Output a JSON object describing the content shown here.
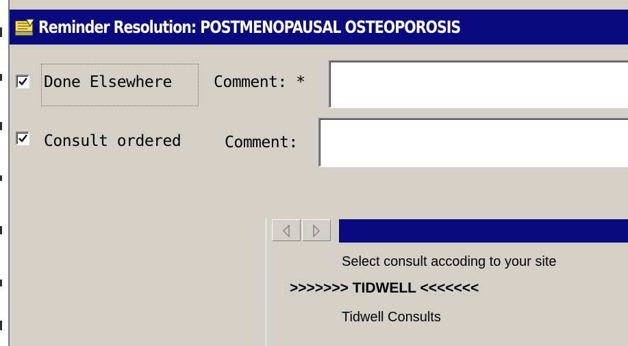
{
  "window": {
    "title": "Reminder Resolution: POSTMENOPAUSAL OSTEOPOROSIS"
  },
  "rows": [
    {
      "checked": true,
      "label": "Done Elsewhere",
      "comment_label": "Comment: *",
      "comment_value": ""
    },
    {
      "checked": true,
      "label": "Consult ordered",
      "comment_label": "Comment:",
      "comment_value": ""
    }
  ],
  "subpanel": {
    "nav_prev_icon": "triangle-left-icon",
    "nav_next_icon": "triangle-right-icon",
    "lines": [
      "Select consult accoding to your site",
      ">>>>>>> TIDWELL <<<<<<<",
      "Tidwell Consults"
    ]
  },
  "colors": {
    "titlebar": "#0a0a7e",
    "dialog_bg": "#d4d0c8"
  }
}
